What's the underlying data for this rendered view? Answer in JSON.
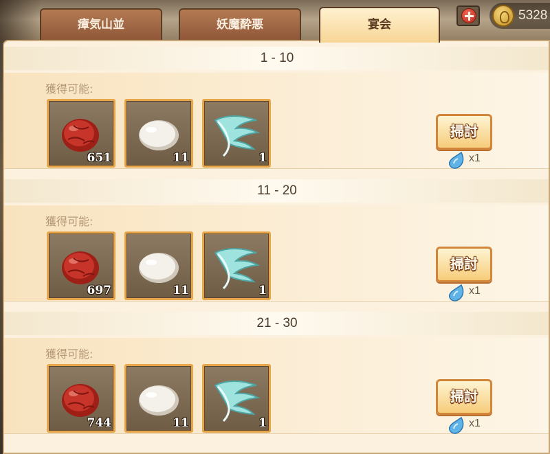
{
  "tabs": [
    {
      "label": "瘴気山並",
      "active": false
    },
    {
      "label": "妖魔酔悪",
      "active": false
    },
    {
      "label": "宴会",
      "active": true
    }
  ],
  "currency": {
    "value": "5328",
    "icon": "coin-icon"
  },
  "obtain_label": "獲得可能:",
  "sweep_label": "掃討",
  "stages": [
    {
      "range": "1 - 10",
      "items": [
        {
          "icon": "red-jujube-icon",
          "count": "651"
        },
        {
          "icon": "white-egg-icon",
          "count": "11"
        },
        {
          "icon": "feather-wing-icon",
          "count": "1"
        }
      ],
      "cost": "x1"
    },
    {
      "range": "11 - 20",
      "items": [
        {
          "icon": "red-jujube-icon",
          "count": "697"
        },
        {
          "icon": "white-egg-icon",
          "count": "11"
        },
        {
          "icon": "feather-wing-icon",
          "count": "1"
        }
      ],
      "cost": "x1"
    },
    {
      "range": "21 - 30",
      "items": [
        {
          "icon": "red-jujube-icon",
          "count": "744"
        },
        {
          "icon": "white-egg-icon",
          "count": "11"
        },
        {
          "icon": "feather-wing-icon",
          "count": "1"
        }
      ],
      "cost": "x1"
    }
  ],
  "colors": {
    "tab_active": "#f7d596",
    "tab_inactive": "#8e5637",
    "item_border": "#e8a64a",
    "button_border": "#d2863b"
  }
}
